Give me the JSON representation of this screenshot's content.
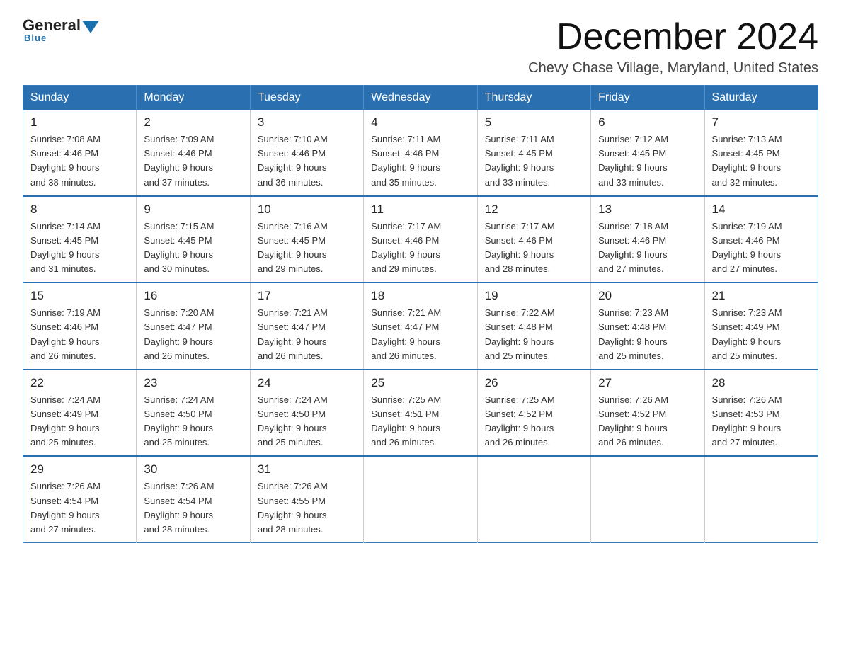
{
  "logo": {
    "general": "General",
    "blue": "Blue",
    "underline": "Blue"
  },
  "header": {
    "title": "December 2024",
    "location": "Chevy Chase Village, Maryland, United States"
  },
  "days_of_week": [
    "Sunday",
    "Monday",
    "Tuesday",
    "Wednesday",
    "Thursday",
    "Friday",
    "Saturday"
  ],
  "weeks": [
    [
      {
        "day": "1",
        "sunrise": "7:08 AM",
        "sunset": "4:46 PM",
        "daylight": "9 hours and 38 minutes."
      },
      {
        "day": "2",
        "sunrise": "7:09 AM",
        "sunset": "4:46 PM",
        "daylight": "9 hours and 37 minutes."
      },
      {
        "day": "3",
        "sunrise": "7:10 AM",
        "sunset": "4:46 PM",
        "daylight": "9 hours and 36 minutes."
      },
      {
        "day": "4",
        "sunrise": "7:11 AM",
        "sunset": "4:46 PM",
        "daylight": "9 hours and 35 minutes."
      },
      {
        "day": "5",
        "sunrise": "7:11 AM",
        "sunset": "4:45 PM",
        "daylight": "9 hours and 33 minutes."
      },
      {
        "day": "6",
        "sunrise": "7:12 AM",
        "sunset": "4:45 PM",
        "daylight": "9 hours and 33 minutes."
      },
      {
        "day": "7",
        "sunrise": "7:13 AM",
        "sunset": "4:45 PM",
        "daylight": "9 hours and 32 minutes."
      }
    ],
    [
      {
        "day": "8",
        "sunrise": "7:14 AM",
        "sunset": "4:45 PM",
        "daylight": "9 hours and 31 minutes."
      },
      {
        "day": "9",
        "sunrise": "7:15 AM",
        "sunset": "4:45 PM",
        "daylight": "9 hours and 30 minutes."
      },
      {
        "day": "10",
        "sunrise": "7:16 AM",
        "sunset": "4:45 PM",
        "daylight": "9 hours and 29 minutes."
      },
      {
        "day": "11",
        "sunrise": "7:17 AM",
        "sunset": "4:46 PM",
        "daylight": "9 hours and 29 minutes."
      },
      {
        "day": "12",
        "sunrise": "7:17 AM",
        "sunset": "4:46 PM",
        "daylight": "9 hours and 28 minutes."
      },
      {
        "day": "13",
        "sunrise": "7:18 AM",
        "sunset": "4:46 PM",
        "daylight": "9 hours and 27 minutes."
      },
      {
        "day": "14",
        "sunrise": "7:19 AM",
        "sunset": "4:46 PM",
        "daylight": "9 hours and 27 minutes."
      }
    ],
    [
      {
        "day": "15",
        "sunrise": "7:19 AM",
        "sunset": "4:46 PM",
        "daylight": "9 hours and 26 minutes."
      },
      {
        "day": "16",
        "sunrise": "7:20 AM",
        "sunset": "4:47 PM",
        "daylight": "9 hours and 26 minutes."
      },
      {
        "day": "17",
        "sunrise": "7:21 AM",
        "sunset": "4:47 PM",
        "daylight": "9 hours and 26 minutes."
      },
      {
        "day": "18",
        "sunrise": "7:21 AM",
        "sunset": "4:47 PM",
        "daylight": "9 hours and 26 minutes."
      },
      {
        "day": "19",
        "sunrise": "7:22 AM",
        "sunset": "4:48 PM",
        "daylight": "9 hours and 25 minutes."
      },
      {
        "day": "20",
        "sunrise": "7:23 AM",
        "sunset": "4:48 PM",
        "daylight": "9 hours and 25 minutes."
      },
      {
        "day": "21",
        "sunrise": "7:23 AM",
        "sunset": "4:49 PM",
        "daylight": "9 hours and 25 minutes."
      }
    ],
    [
      {
        "day": "22",
        "sunrise": "7:24 AM",
        "sunset": "4:49 PM",
        "daylight": "9 hours and 25 minutes."
      },
      {
        "day": "23",
        "sunrise": "7:24 AM",
        "sunset": "4:50 PM",
        "daylight": "9 hours and 25 minutes."
      },
      {
        "day": "24",
        "sunrise": "7:24 AM",
        "sunset": "4:50 PM",
        "daylight": "9 hours and 25 minutes."
      },
      {
        "day": "25",
        "sunrise": "7:25 AM",
        "sunset": "4:51 PM",
        "daylight": "9 hours and 26 minutes."
      },
      {
        "day": "26",
        "sunrise": "7:25 AM",
        "sunset": "4:52 PM",
        "daylight": "9 hours and 26 minutes."
      },
      {
        "day": "27",
        "sunrise": "7:26 AM",
        "sunset": "4:52 PM",
        "daylight": "9 hours and 26 minutes."
      },
      {
        "day": "28",
        "sunrise": "7:26 AM",
        "sunset": "4:53 PM",
        "daylight": "9 hours and 27 minutes."
      }
    ],
    [
      {
        "day": "29",
        "sunrise": "7:26 AM",
        "sunset": "4:54 PM",
        "daylight": "9 hours and 27 minutes."
      },
      {
        "day": "30",
        "sunrise": "7:26 AM",
        "sunset": "4:54 PM",
        "daylight": "9 hours and 28 minutes."
      },
      {
        "day": "31",
        "sunrise": "7:26 AM",
        "sunset": "4:55 PM",
        "daylight": "9 hours and 28 minutes."
      },
      null,
      null,
      null,
      null
    ]
  ],
  "labels": {
    "sunrise": "Sunrise:",
    "sunset": "Sunset:",
    "daylight": "Daylight:"
  },
  "colors": {
    "header_bg": "#2a6faf",
    "border": "#2a6faf"
  }
}
